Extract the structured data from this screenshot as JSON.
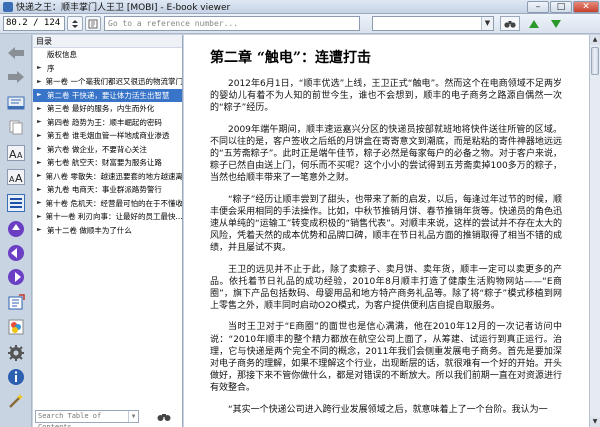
{
  "window": {
    "title": "快递之王：顺丰掌门人王卫 [MOBI] - E-book viewer",
    "minimize_label": "–",
    "maximize_label": "□",
    "close_label": "✕"
  },
  "toolbar": {
    "page_value": "80.2 / 124",
    "reference_placeholder": "Go to a reference number...",
    "search_placeholder": ""
  },
  "toc": {
    "header": "目录",
    "items": [
      {
        "label": "版权信息"
      },
      {
        "label": "序"
      },
      {
        "label": "第一卷  一个毫我们都迟又很迅的物流掌门"
      },
      {
        "label": "第二卷  干快递，要让体力活生出智慧"
      },
      {
        "label": "第三卷  最好的服务，内生而外化"
      },
      {
        "label": "第四卷  趋势为王：顺丰崛起的密码"
      },
      {
        "label": "第五卷  谁毛烟血管一样地成商业渗透"
      },
      {
        "label": "第六卷  做企业，不要背心关注"
      },
      {
        "label": "第七卷  航空天：财富要为服务让路"
      },
      {
        "label": "第八卷  零散失：越速迅要套的地方越速离"
      },
      {
        "label": "第九卷  电商天：事业群派路势警行"
      },
      {
        "label": "第十卷  危机天：经营最可怕的在于不懂收"
      },
      {
        "label": "第十一卷  利刃向事：让最好的员工最快..."
      },
      {
        "label": "第十二卷  做顺丰为了什么"
      }
    ],
    "search_placeholder": "Search Table of Contents"
  },
  "document": {
    "chapter_title": "第二章 “触电”：连遭打击",
    "paragraphs": [
      "2012年6月1日，“顺丰优选”上线，王卫正式“触电”。然而这个在电商领域不足两岁的婴幼儿有着不为人知的前世今生，谁也不会想到，顺丰的电子商务之路源自偶然一次的“粽子”经历。",
      "2009年端午期间，顺丰速运嘉兴分区的快递员按部就班地将快件送往所管的区域。不同以往的是，客户签收之后纸的月饼盒在寄寄意文到潮底，而是粘粘的寄件神器地远远的“五芳斋粽子”。此时正是端午佳节，粽子必然是每家每户的必备之物。对于客户来说，粽子已然自由送上门，何乐而不买呢？这个小小的尝试得到五芳斋卖掉100多万的粽子，当然也给顺丰带来了一笔意外之财。",
      "“粽子”经历让顺丰尝到了甜头，也带来了新的启发，以后，每逢过年过节的时候，顺丰便会采用相同的手法操作。比如，中秋节推销月饼、春节推销年货等。快递员的角色迅速从单纯的“运输工”转变成积极的“销售代表”。对顺丰来说，这样的尝试并不存在太大的风险，凭着天然的成本优势和品牌口碑，顺丰在节日礼品方面的推销取得了相当不错的成绩，并且屡试不爽。",
      "王卫的远见并不止于此，除了卖粽子、卖月饼、卖年货，顺丰一定可以卖更多的产品。依托着节日礼品的成功经验，2010年8月顺丰打造了健康生活购物网站——“E商圈”，旗下产品包括数码、母婴用品和地方特产商务礼品等。除了将“粽子”模式移植到网上零售之外，顺丰同时启动O2O模式，为客户提供便利店自提自取服务。",
      "当时王卫对于“E商圈”的面世也是信心满满，他在2010年12月的一次记者访问中说：“2010年顺丰的整个精力都放在航空公司上面了，从筹建、试运行到真正运行。治理，它与快递是两个完全不同的概念，2011年我们会侧重发展电子商务。首先是要加深对电子商务的理解，如果不理解这个行业，出现断层的话，就很难有一个好的开始。开头做好，那接下来不管你做什么，都是对错误的不断放大。所以我们前期一直在对资源进行有效整合。",
      "“其实一个快递公司进入跨行业发展领域之后，就意味着上了一个台阶。我认为一"
    ]
  },
  "colors": {
    "selection": "#3874c8",
    "chrome": "#c9d4e2",
    "accent_green": "#2a9a2a"
  }
}
